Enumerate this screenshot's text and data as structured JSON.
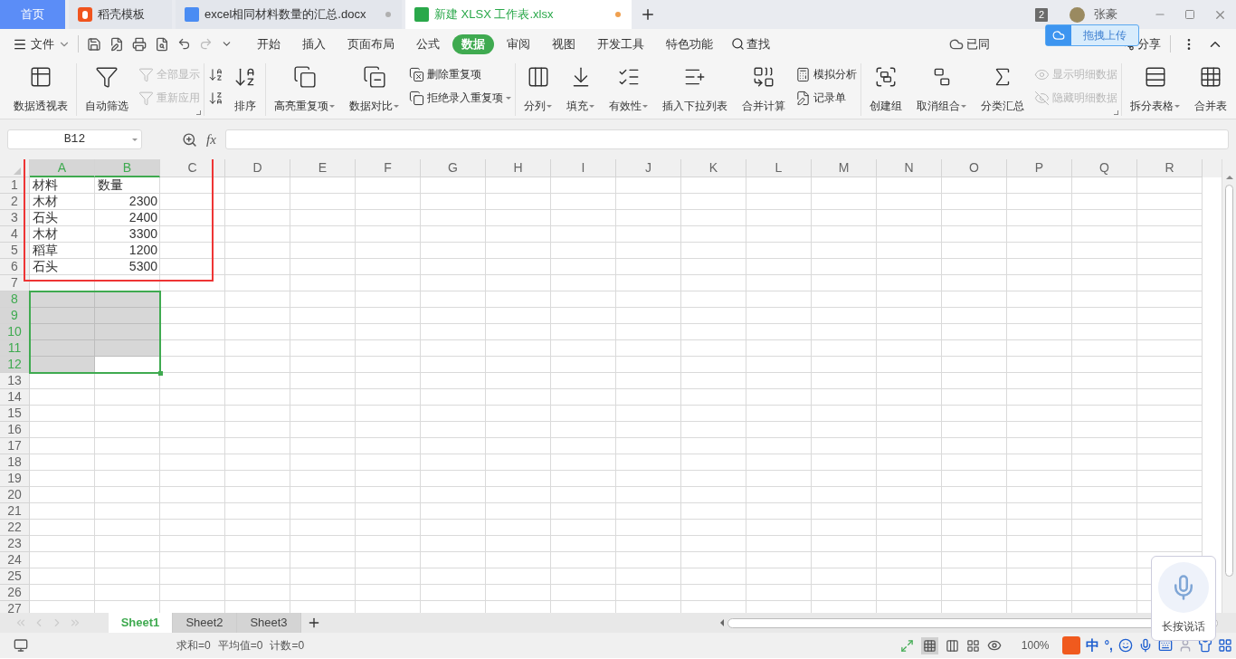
{
  "doc_tabs": [
    {
      "kind": "home",
      "label": "首页",
      "selected": false
    },
    {
      "kind": "template",
      "label": "稻壳模板",
      "selected": false
    },
    {
      "kind": "word",
      "label": "excel相同材料数量的汇总.docx",
      "selected": false,
      "modified": false
    },
    {
      "kind": "sheet",
      "label": "新建 XLSX 工作表.xlsx",
      "selected": true,
      "modified": true
    }
  ],
  "window_badge": "2",
  "user": {
    "name": "张豪"
  },
  "menu": {
    "file": "文件",
    "tabs": [
      {
        "label": "开始",
        "selected": false
      },
      {
        "label": "插入",
        "selected": false
      },
      {
        "label": "页面布局",
        "selected": false
      },
      {
        "label": "公式",
        "selected": false
      },
      {
        "label": "数据",
        "selected": true
      },
      {
        "label": "审阅",
        "selected": false
      },
      {
        "label": "视图",
        "selected": false
      },
      {
        "label": "开发工具",
        "selected": false
      },
      {
        "label": "特色功能",
        "selected": false
      }
    ],
    "search": "查找",
    "sync": "已同",
    "share": "分享"
  },
  "upload_popup": "拖拽上传",
  "ribbon": [
    {
      "items": [
        {
          "label": "数据透视表",
          "kind": "large",
          "dropdown": false,
          "disabled": false
        }
      ]
    },
    {
      "launcher": true,
      "items": [
        {
          "label": "自动筛选",
          "kind": "large",
          "dropdown": false,
          "disabled": false
        },
        {
          "label": "全部显示",
          "kind": "small",
          "dropdown": false,
          "disabled": true
        },
        {
          "label": "重新应用",
          "kind": "small",
          "dropdown": false,
          "disabled": true
        }
      ]
    },
    {
      "items": [
        {
          "kind": "small",
          "dropdown": false,
          "disabled": false
        },
        {
          "kind": "small",
          "dropdown": false,
          "disabled": false
        },
        {
          "label": "排序",
          "kind": "large",
          "dropdown": false,
          "disabled": false
        }
      ]
    },
    {
      "items": [
        {
          "label": "高亮重复项",
          "kind": "large",
          "dropdown": true,
          "disabled": false
        },
        {
          "label": "数据对比",
          "kind": "large",
          "dropdown": true,
          "disabled": false
        },
        {
          "label": "删除重复项",
          "kind": "small",
          "dropdown": false,
          "disabled": false
        },
        {
          "label": "拒绝录入重复项",
          "kind": "small",
          "dropdown": true,
          "disabled": false
        }
      ]
    },
    {
      "items": [
        {
          "label": "分列",
          "kind": "large",
          "dropdown": true,
          "disabled": false
        },
        {
          "label": "填充",
          "kind": "large",
          "dropdown": true,
          "disabled": false
        },
        {
          "label": "有效性",
          "kind": "large",
          "dropdown": true,
          "disabled": false
        },
        {
          "label": "插入下拉列表",
          "kind": "large",
          "dropdown": false,
          "disabled": false
        },
        {
          "label": "合并计算",
          "kind": "large",
          "dropdown": false,
          "disabled": false
        },
        {
          "label": "模拟分析",
          "kind": "small",
          "dropdown": false,
          "disabled": false
        },
        {
          "label": "记录单",
          "kind": "small",
          "dropdown": false,
          "disabled": false
        }
      ]
    },
    {
      "launcher": true,
      "items": [
        {
          "label": "创建组",
          "kind": "large",
          "dropdown": false,
          "disabled": false
        },
        {
          "label": "取消组合",
          "kind": "large",
          "dropdown": true,
          "disabled": false
        },
        {
          "label": "分类汇总",
          "kind": "large",
          "dropdown": false,
          "disabled": false
        },
        {
          "label": "显示明细数据",
          "kind": "small",
          "dropdown": false,
          "disabled": true
        },
        {
          "label": "隐藏明细数据",
          "kind": "small",
          "dropdown": false,
          "disabled": true
        }
      ]
    },
    {
      "items": [
        {
          "label": "拆分表格",
          "kind": "large",
          "dropdown": true,
          "disabled": false
        },
        {
          "label": "合并表",
          "kind": "large",
          "dropdown": false,
          "disabled": false
        }
      ]
    }
  ],
  "name_box": "B12",
  "fx": "fx",
  "columns": [
    {
      "label": "A",
      "selected": true
    },
    {
      "label": "B",
      "selected": true
    },
    {
      "label": "C",
      "selected": false
    },
    {
      "label": "D",
      "selected": false
    },
    {
      "label": "E",
      "selected": false
    },
    {
      "label": "F",
      "selected": false
    },
    {
      "label": "G",
      "selected": false
    },
    {
      "label": "H",
      "selected": false
    },
    {
      "label": "I",
      "selected": false
    },
    {
      "label": "J",
      "selected": false
    },
    {
      "label": "K",
      "selected": false
    },
    {
      "label": "L",
      "selected": false
    },
    {
      "label": "M",
      "selected": false
    },
    {
      "label": "N",
      "selected": false
    },
    {
      "label": "O",
      "selected": false
    },
    {
      "label": "P",
      "selected": false
    },
    {
      "label": "Q",
      "selected": false
    },
    {
      "label": "R",
      "selected": false
    }
  ],
  "rows": [
    {
      "label": "1",
      "selected": false,
      "cells": [
        {
          "text": "材料",
          "kind": "text"
        },
        {
          "text": "数量",
          "kind": "text"
        }
      ]
    },
    {
      "label": "2",
      "selected": false,
      "cells": [
        {
          "text": "木材",
          "kind": "text"
        },
        {
          "text": "2300",
          "kind": "number"
        }
      ]
    },
    {
      "label": "3",
      "selected": false,
      "cells": [
        {
          "text": "石头",
          "kind": "text"
        },
        {
          "text": "2400",
          "kind": "number"
        }
      ]
    },
    {
      "label": "4",
      "selected": false,
      "cells": [
        {
          "text": "木材",
          "kind": "text"
        },
        {
          "text": "3300",
          "kind": "number"
        }
      ]
    },
    {
      "label": "5",
      "selected": false,
      "cells": [
        {
          "text": "稻草",
          "kind": "text"
        },
        {
          "text": "1200",
          "kind": "number"
        }
      ]
    },
    {
      "label": "6",
      "selected": false,
      "cells": [
        {
          "text": "石头",
          "kind": "text"
        },
        {
          "text": "5300",
          "kind": "number"
        }
      ]
    },
    {
      "label": "7",
      "selected": false
    },
    {
      "label": "8",
      "selected": true,
      "cells": [
        {
          "selected": true
        },
        {
          "selected": true
        }
      ]
    },
    {
      "label": "9",
      "selected": true,
      "cells": [
        {
          "selected": true
        },
        {
          "selected": true
        }
      ]
    },
    {
      "label": "10",
      "selected": true,
      "cells": [
        {
          "selected": true
        },
        {
          "selected": true
        }
      ]
    },
    {
      "label": "11",
      "selected": true,
      "cells": [
        {
          "selected": true
        },
        {
          "selected": true
        }
      ]
    },
    {
      "label": "12",
      "selected": true,
      "cells": [
        {
          "selected": true
        },
        {
          "selected": false
        }
      ]
    },
    {
      "label": "13",
      "selected": false
    },
    {
      "label": "14",
      "selected": false
    },
    {
      "label": "15",
      "selected": false
    },
    {
      "label": "16",
      "selected": false
    },
    {
      "label": "17",
      "selected": false
    },
    {
      "label": "18",
      "selected": false
    },
    {
      "label": "19",
      "selected": false
    },
    {
      "label": "20",
      "selected": false
    },
    {
      "label": "21",
      "selected": false
    },
    {
      "label": "22",
      "selected": false
    },
    {
      "label": "23",
      "selected": false
    },
    {
      "label": "24",
      "selected": false
    },
    {
      "label": "25",
      "selected": false
    },
    {
      "label": "26",
      "selected": false
    },
    {
      "label": "27",
      "selected": false
    }
  ],
  "sheets": [
    {
      "label": "Sheet1",
      "selected": true
    },
    {
      "label": "Sheet2",
      "selected": false
    },
    {
      "label": "Sheet3",
      "selected": false
    }
  ],
  "status": {
    "stats": [
      "求和=0",
      "平均值=0",
      "计数=0"
    ],
    "zoom": "100%"
  },
  "ime": {
    "mode": "中",
    "punct": "°,"
  },
  "voice": {
    "label": "长按说话"
  }
}
